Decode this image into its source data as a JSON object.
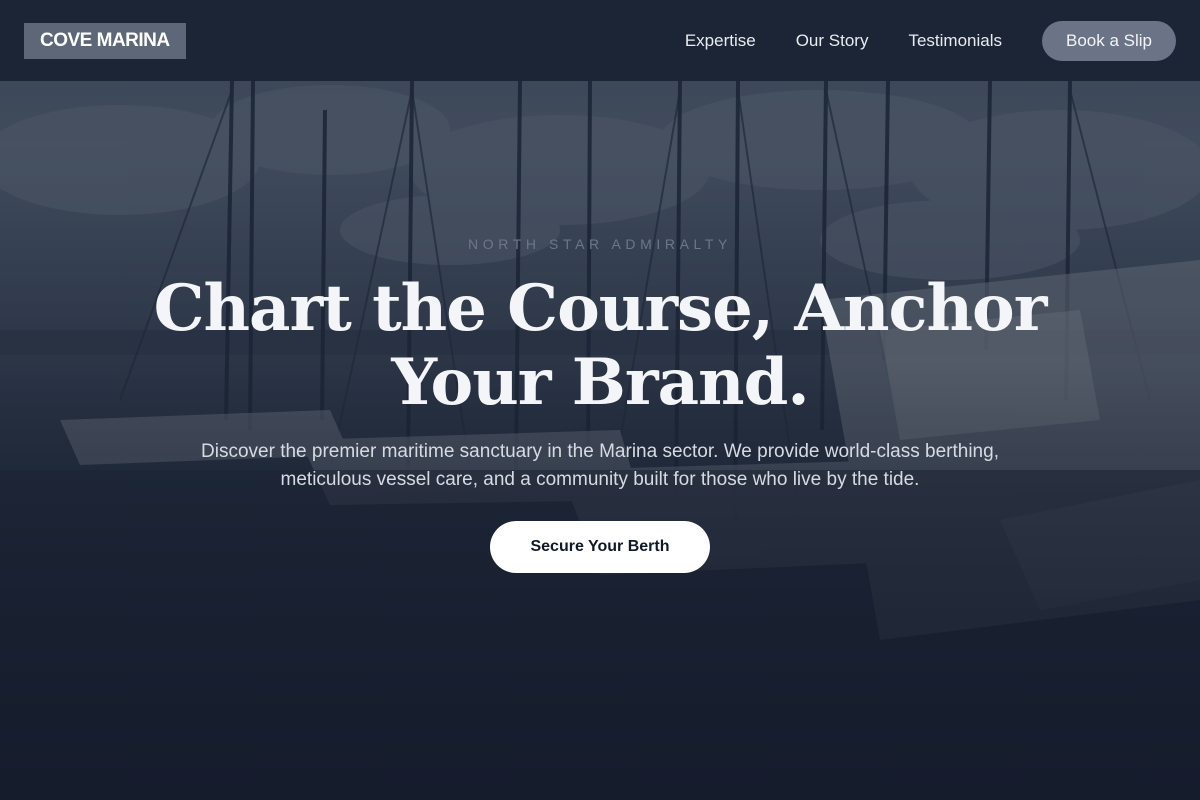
{
  "header": {
    "logo": "COVE MARINA",
    "nav": [
      {
        "label": "Expertise"
      },
      {
        "label": "Our Story"
      },
      {
        "label": "Testimonials"
      }
    ],
    "cta_label": "Book a Slip"
  },
  "hero": {
    "eyebrow": "NORTH STAR ADMIRALTY",
    "headline": "Chart the Course, Anchor Your Brand.",
    "lede": "Discover the premier maritime sanctuary in the Marina sector. We provide world-class berthing, meticulous vessel care, and a community built for those who live by the tide.",
    "cta_label": "Secure Your Berth",
    "background_image": "marina-sailboats-photo"
  },
  "colors": {
    "header_bg": "#1c2536",
    "logo_bg": "#5d6778",
    "nav_cta_bg": "#6b7486",
    "hero_cta_bg": "#ffffff",
    "page_bg": "#1a2233"
  }
}
